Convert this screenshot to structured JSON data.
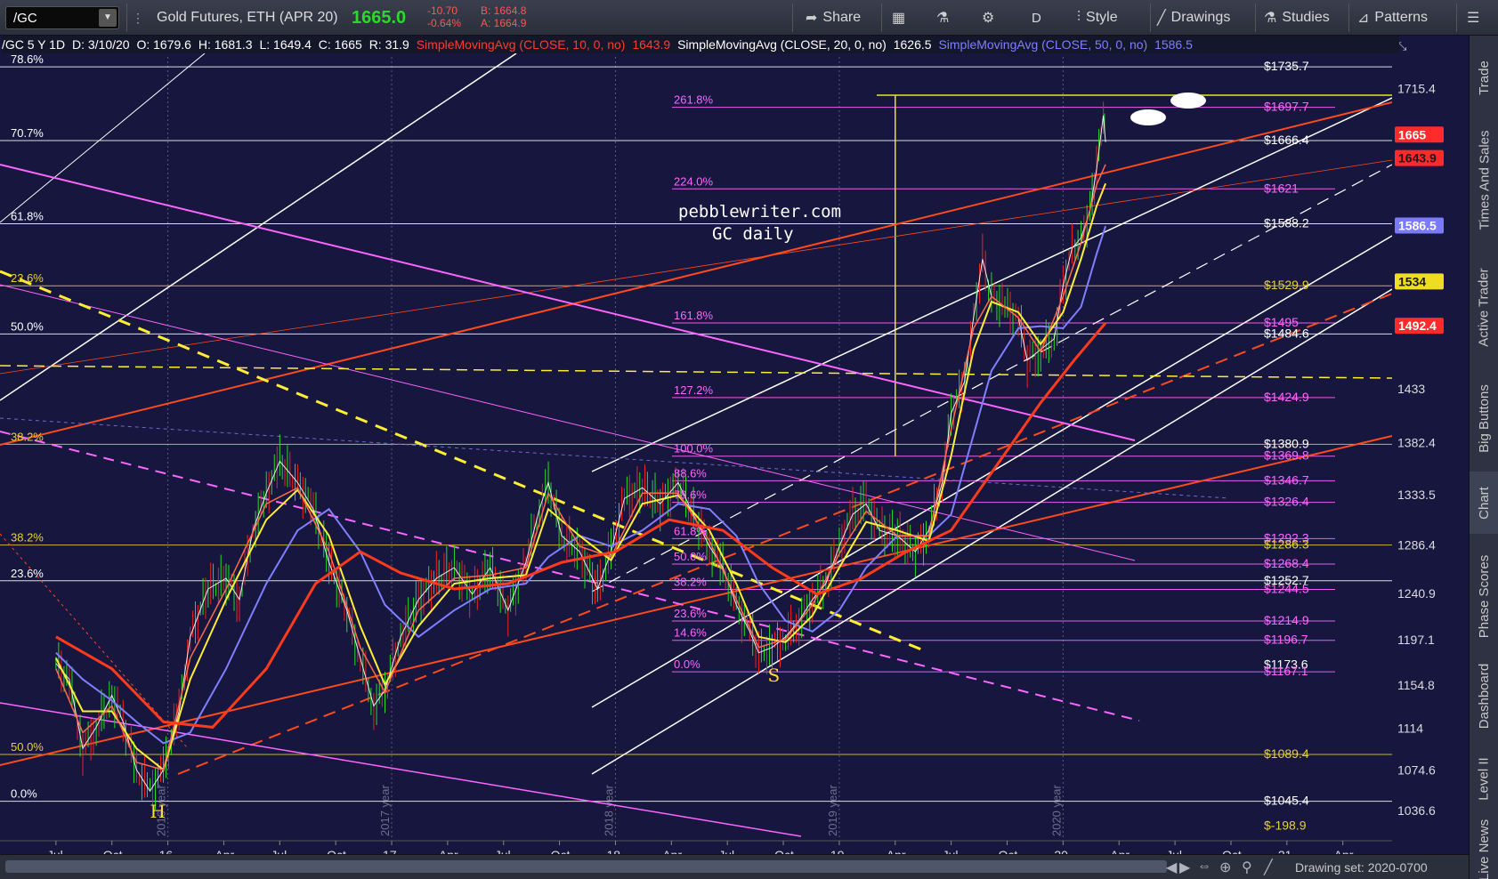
{
  "toolbar": {
    "symbol": "/GC",
    "instrument": "Gold Futures, ETH (APR 20)",
    "last": "1665.0",
    "change": "-10.70",
    "change_pct": "-0.64%",
    "bid": "B: 1664.8",
    "ask": "A: 1664.9",
    "share_label": "Share",
    "period_label": "D",
    "style_label": "Style",
    "drawings_label": "Drawings",
    "studies_label": "Studies",
    "patterns_label": "Patterns"
  },
  "header": {
    "desc": "/GC 5 Y 1D",
    "date": "D: 3/10/20",
    "open": "O: 1679.6",
    "high": "H: 1681.3",
    "low": "L: 1649.4",
    "close": "C: 1665",
    "range": "R: 31.9",
    "sma10": "SimpleMovingAvg (CLOSE, 10, 0, no)",
    "sma10_val": "1643.9",
    "sma20": "SimpleMovingAvg (CLOSE, 20, 0, no)",
    "sma20_val": "1626.5",
    "sma50": "SimpleMovingAvg (CLOSE, 50, 0, no)",
    "sma50_val": "1586.5"
  },
  "watermark": {
    "line1": "pebblewriter.com",
    "line2": "GC daily"
  },
  "sidebar": {
    "tabs": [
      "Trade",
      "Times And Sales",
      "Active Trader",
      "Big Buttons",
      "Chart",
      "Phase Scores",
      "Dashboard",
      "Level II",
      "Live News"
    ]
  },
  "bottom": {
    "drawing_set": "Drawing set: 2020-0700"
  },
  "colors": {
    "background": "#16163f",
    "price_up": "#22dd22",
    "price_down": "#ee2222",
    "sma10": "#ff3b2f",
    "sma20": "#ffffff",
    "sma50": "#7f7fff",
    "fib_pink": "#ff66ff",
    "fib_yellow": "#e6d22a",
    "channel_white": "#ffffff",
    "channel_orange": "#ff4a1c"
  },
  "chart_data": {
    "type": "candlestick",
    "ylim": [
      1010,
      1745
    ],
    "y_ticks": [
      "1715.4",
      "1433",
      "1382.4",
      "1333.5",
      "1286.4",
      "1240.9",
      "1197.1",
      "1154.8",
      "1114",
      "1074.6",
      "1036.6"
    ],
    "x_labels": [
      "Jul",
      "Oct",
      "16",
      "Apr",
      "Jul",
      "Oct",
      "17",
      "Apr",
      "Jul",
      "Oct",
      "18",
      "Apr",
      "Jul",
      "Oct",
      "19",
      "Apr",
      "Jul",
      "Oct",
      "20",
      "Apr",
      "Jul",
      "Oct",
      "21",
      "Apr"
    ],
    "year_labels": [
      "2016 year",
      "2017 year",
      "2018 year",
      "2019 year",
      "2020 year"
    ],
    "price_path": [
      [
        2015.5,
        1175
      ],
      [
        2015.56,
        1160
      ],
      [
        2015.62,
        1095
      ],
      [
        2015.68,
        1115
      ],
      [
        2015.75,
        1145
      ],
      [
        2015.8,
        1120
      ],
      [
        2015.86,
        1075
      ],
      [
        2015.92,
        1055
      ],
      [
        2015.98,
        1075
      ],
      [
        2016.05,
        1130
      ],
      [
        2016.1,
        1200
      ],
      [
        2016.18,
        1245
      ],
      [
        2016.26,
        1255
      ],
      [
        2016.32,
        1235
      ],
      [
        2016.38,
        1300
      ],
      [
        2016.44,
        1335
      ],
      [
        2016.5,
        1365
      ],
      [
        2016.58,
        1345
      ],
      [
        2016.65,
        1320
      ],
      [
        2016.72,
        1270
      ],
      [
        2016.8,
        1225
      ],
      [
        2016.86,
        1180
      ],
      [
        2016.92,
        1135
      ],
      [
        2016.97,
        1150
      ],
      [
        2017.04,
        1200
      ],
      [
        2017.12,
        1235
      ],
      [
        2017.2,
        1255
      ],
      [
        2017.28,
        1265
      ],
      [
        2017.36,
        1240
      ],
      [
        2017.44,
        1265
      ],
      [
        2017.52,
        1225
      ],
      [
        2017.6,
        1270
      ],
      [
        2017.66,
        1320
      ],
      [
        2017.7,
        1345
      ],
      [
        2017.76,
        1295
      ],
      [
        2017.84,
        1280
      ],
      [
        2017.92,
        1245
      ],
      [
        2017.98,
        1280
      ],
      [
        2018.04,
        1330
      ],
      [
        2018.12,
        1340
      ],
      [
        2018.2,
        1325
      ],
      [
        2018.28,
        1345
      ],
      [
        2018.36,
        1310
      ],
      [
        2018.42,
        1285
      ],
      [
        2018.48,
        1265
      ],
      [
        2018.54,
        1230
      ],
      [
        2018.6,
        1205
      ],
      [
        2018.64,
        1185
      ],
      [
        2018.7,
        1190
      ],
      [
        2018.76,
        1200
      ],
      [
        2018.82,
        1215
      ],
      [
        2018.88,
        1235
      ],
      [
        2018.94,
        1250
      ],
      [
        2019.0,
        1285
      ],
      [
        2019.06,
        1315
      ],
      [
        2019.12,
        1325
      ],
      [
        2019.18,
        1300
      ],
      [
        2019.26,
        1295
      ],
      [
        2019.34,
        1280
      ],
      [
        2019.4,
        1300
      ],
      [
        2019.46,
        1345
      ],
      [
        2019.5,
        1410
      ],
      [
        2019.56,
        1440
      ],
      [
        2019.6,
        1500
      ],
      [
        2019.64,
        1555
      ],
      [
        2019.68,
        1520
      ],
      [
        2019.74,
        1510
      ],
      [
        2019.8,
        1500
      ],
      [
        2019.84,
        1460
      ],
      [
        2019.9,
        1470
      ],
      [
        2019.96,
        1480
      ],
      [
        2020.0,
        1530
      ],
      [
        2020.04,
        1565
      ],
      [
        2020.08,
        1575
      ],
      [
        2020.12,
        1600
      ],
      [
        2020.15,
        1640
      ],
      [
        2020.18,
        1690
      ],
      [
        2020.19,
        1665
      ]
    ],
    "sma10": [
      [
        2015.5,
        1170
      ],
      [
        2015.62,
        1110
      ],
      [
        2015.75,
        1135
      ],
      [
        2015.86,
        1082
      ],
      [
        2015.98,
        1075
      ],
      [
        2016.1,
        1180
      ],
      [
        2016.26,
        1245
      ],
      [
        2016.44,
        1325
      ],
      [
        2016.58,
        1340
      ],
      [
        2016.72,
        1280
      ],
      [
        2016.86,
        1190
      ],
      [
        2016.97,
        1148
      ],
      [
        2017.12,
        1225
      ],
      [
        2017.28,
        1255
      ],
      [
        2017.44,
        1258
      ],
      [
        2017.6,
        1265
      ],
      [
        2017.7,
        1335
      ],
      [
        2017.84,
        1285
      ],
      [
        2017.98,
        1275
      ],
      [
        2018.12,
        1335
      ],
      [
        2018.28,
        1335
      ],
      [
        2018.42,
        1290
      ],
      [
        2018.54,
        1235
      ],
      [
        2018.64,
        1190
      ],
      [
        2018.76,
        1198
      ],
      [
        2018.88,
        1230
      ],
      [
        2019.0,
        1278
      ],
      [
        2019.12,
        1318
      ],
      [
        2019.26,
        1295
      ],
      [
        2019.4,
        1295
      ],
      [
        2019.5,
        1395
      ],
      [
        2019.6,
        1490
      ],
      [
        2019.68,
        1520
      ],
      [
        2019.8,
        1500
      ],
      [
        2019.9,
        1468
      ],
      [
        2020.0,
        1520
      ],
      [
        2020.08,
        1570
      ],
      [
        2020.15,
        1625
      ],
      [
        2020.19,
        1644
      ]
    ],
    "sma20": [
      [
        2015.5,
        1180
      ],
      [
        2015.62,
        1130
      ],
      [
        2015.75,
        1130
      ],
      [
        2015.86,
        1095
      ],
      [
        2015.98,
        1075
      ],
      [
        2016.1,
        1160
      ],
      [
        2016.26,
        1235
      ],
      [
        2016.44,
        1310
      ],
      [
        2016.58,
        1338
      ],
      [
        2016.72,
        1295
      ],
      [
        2016.86,
        1210
      ],
      [
        2016.97,
        1155
      ],
      [
        2017.12,
        1210
      ],
      [
        2017.28,
        1250
      ],
      [
        2017.44,
        1255
      ],
      [
        2017.6,
        1258
      ],
      [
        2017.7,
        1320
      ],
      [
        2017.84,
        1295
      ],
      [
        2017.98,
        1272
      ],
      [
        2018.12,
        1325
      ],
      [
        2018.28,
        1333
      ],
      [
        2018.42,
        1300
      ],
      [
        2018.54,
        1250
      ],
      [
        2018.64,
        1200
      ],
      [
        2018.76,
        1195
      ],
      [
        2018.88,
        1220
      ],
      [
        2019.0,
        1265
      ],
      [
        2019.12,
        1308
      ],
      [
        2019.26,
        1300
      ],
      [
        2019.4,
        1290
      ],
      [
        2019.5,
        1370
      ],
      [
        2019.6,
        1470
      ],
      [
        2019.68,
        1515
      ],
      [
        2019.8,
        1505
      ],
      [
        2019.9,
        1475
      ],
      [
        2020.0,
        1505
      ],
      [
        2020.08,
        1555
      ],
      [
        2020.15,
        1605
      ],
      [
        2020.19,
        1626
      ]
    ],
    "sma50": [
      [
        2015.5,
        1185
      ],
      [
        2015.62,
        1160
      ],
      [
        2015.75,
        1140
      ],
      [
        2015.86,
        1120
      ],
      [
        2015.98,
        1100
      ],
      [
        2016.1,
        1110
      ],
      [
        2016.26,
        1170
      ],
      [
        2016.44,
        1250
      ],
      [
        2016.58,
        1300
      ],
      [
        2016.72,
        1320
      ],
      [
        2016.86,
        1280
      ],
      [
        2016.97,
        1230
      ],
      [
        2017.12,
        1200
      ],
      [
        2017.28,
        1225
      ],
      [
        2017.44,
        1245
      ],
      [
        2017.6,
        1250
      ],
      [
        2017.7,
        1275
      ],
      [
        2017.84,
        1295
      ],
      [
        2017.98,
        1285
      ],
      [
        2018.12,
        1300
      ],
      [
        2018.28,
        1325
      ],
      [
        2018.42,
        1320
      ],
      [
        2018.54,
        1295
      ],
      [
        2018.64,
        1250
      ],
      [
        2018.76,
        1215
      ],
      [
        2018.88,
        1205
      ],
      [
        2019.0,
        1225
      ],
      [
        2019.12,
        1265
      ],
      [
        2019.26,
        1295
      ],
      [
        2019.4,
        1295
      ],
      [
        2019.5,
        1315
      ],
      [
        2019.6,
        1390
      ],
      [
        2019.68,
        1450
      ],
      [
        2019.8,
        1490
      ],
      [
        2019.9,
        1492
      ],
      [
        2020.0,
        1490
      ],
      [
        2020.08,
        1510
      ],
      [
        2020.15,
        1560
      ],
      [
        2020.19,
        1586
      ]
    ],
    "sma200": [
      [
        2015.5,
        1200
      ],
      [
        2015.75,
        1170
      ],
      [
        2015.98,
        1120
      ],
      [
        2016.2,
        1115
      ],
      [
        2016.44,
        1170
      ],
      [
        2016.66,
        1250
      ],
      [
        2016.86,
        1280
      ],
      [
        2017.04,
        1260
      ],
      [
        2017.28,
        1245
      ],
      [
        2017.52,
        1250
      ],
      [
        2017.76,
        1270
      ],
      [
        2018.0,
        1280
      ],
      [
        2018.24,
        1310
      ],
      [
        2018.48,
        1300
      ],
      [
        2018.7,
        1265
      ],
      [
        2018.9,
        1240
      ],
      [
        2019.1,
        1255
      ],
      [
        2019.3,
        1280
      ],
      [
        2019.5,
        1300
      ],
      [
        2019.7,
        1360
      ],
      [
        2019.9,
        1420
      ],
      [
        2020.05,
        1460
      ],
      [
        2020.19,
        1495
      ]
    ],
    "fib_left": [
      {
        "label": "78.6%",
        "price": 1735.7,
        "color": "#ffffff"
      },
      {
        "label": "70.7%",
        "price": 1666.4,
        "color": "#ffffff"
      },
      {
        "label": "61.8%",
        "price": 1588.2,
        "color": "#ffffff"
      },
      {
        "label": "23.6%",
        "price": 1529.9,
        "color": "#e6d22a"
      },
      {
        "label": "50.0%",
        "price": 1484.6,
        "color": "#ffffff"
      },
      {
        "label": "38.2%",
        "price": 1380.9,
        "color": "#e6d22a"
      },
      {
        "label": "38.2%",
        "price": 1286.3,
        "color": "#e6d22a"
      },
      {
        "label": "23.6%",
        "price": 1252.7,
        "color": "#ffffff"
      },
      {
        "label": "50.0%",
        "price": 1089.4,
        "color": "#e6d22a"
      },
      {
        "label": "0.0%",
        "price": 1045.4,
        "color": "#ffffff"
      }
    ],
    "fib_mid": [
      {
        "label": "261.8%",
        "price": 1697.7
      },
      {
        "label": "224.0%",
        "price": 1621
      },
      {
        "label": "161.8%",
        "price": 1495
      },
      {
        "label": "127.2%",
        "price": 1424.9
      },
      {
        "label": "100.0%",
        "price": 1369.8
      },
      {
        "label": "88.6%",
        "price": 1346.7
      },
      {
        "label": "78.6%",
        "price": 1326.4
      },
      {
        "label": "61.8%",
        "price": 1292.3
      },
      {
        "label": "50.0%",
        "price": 1268.4
      },
      {
        "label": "38.2%",
        "price": 1244.5
      },
      {
        "label": "23.6%",
        "price": 1214.9
      },
      {
        "label": "14.6%",
        "price": 1196.7
      },
      {
        "label": "0.0%",
        "price": 1167.1
      }
    ],
    "right_labels": [
      {
        "text": "$1735.7",
        "price": 1735.7,
        "color": "#ffffff"
      },
      {
        "text": "$1697.7",
        "price": 1697.7,
        "color": "#ff66ff"
      },
      {
        "text": "$1666.4",
        "price": 1666.4,
        "color": "#ffffff"
      },
      {
        "text": "$1621",
        "price": 1621,
        "color": "#ff66ff"
      },
      {
        "text": "$1588.2",
        "price": 1588.2,
        "color": "#ffffff"
      },
      {
        "text": "$1529.9",
        "price": 1529.9,
        "color": "#e6d22a"
      },
      {
        "text": "$1495",
        "price": 1495,
        "color": "#ff66ff"
      },
      {
        "text": "$1484.6",
        "price": 1484.6,
        "color": "#ffffff"
      },
      {
        "text": "$1424.9",
        "price": 1424.9,
        "color": "#ff66ff"
      },
      {
        "text": "$1380.9",
        "price": 1380.9,
        "color": "#ffffff"
      },
      {
        "text": "$1369.8",
        "price": 1369.8,
        "color": "#ff66ff"
      },
      {
        "text": "$1346.7",
        "price": 1346.7,
        "color": "#ff66ff"
      },
      {
        "text": "$1326.4",
        "price": 1326.4,
        "color": "#ff66ff"
      },
      {
        "text": "$1292.3",
        "price": 1292.3,
        "color": "#ff66ff"
      },
      {
        "text": "$1286.3",
        "price": 1286.3,
        "color": "#e6d22a"
      },
      {
        "text": "$1268.4",
        "price": 1268.4,
        "color": "#ff66ff"
      },
      {
        "text": "$1252.7",
        "price": 1252.7,
        "color": "#ffffff"
      },
      {
        "text": "$1244.5",
        "price": 1244.5,
        "color": "#ff66ff"
      },
      {
        "text": "$1214.9",
        "price": 1214.9,
        "color": "#ff66ff"
      },
      {
        "text": "$1196.7",
        "price": 1196.7,
        "color": "#ff66ff"
      },
      {
        "text": "$1173.6",
        "price": 1173.6,
        "color": "#ffffff"
      },
      {
        "text": "$1167.1",
        "price": 1167.1,
        "color": "#ff66ff"
      },
      {
        "text": "$1089.4",
        "price": 1089.4,
        "color": "#e6d22a"
      },
      {
        "text": "$1045.4",
        "price": 1045.4,
        "color": "#ffffff"
      },
      {
        "text": "$-198.9",
        "price": 1022,
        "color": "#e6d22a"
      }
    ],
    "price_tags": [
      {
        "text": "1665",
        "price": 1672,
        "bg": "#ff2a2a",
        "fg": "#ffffff"
      },
      {
        "text": "1643.9",
        "price": 1650,
        "bg": "#ff2a2a",
        "fg": "#1a1a1a"
      },
      {
        "text": "1586.5",
        "price": 1586.5,
        "bg": "#7a7aff",
        "fg": "#ffffff"
      },
      {
        "text": "1534",
        "price": 1534,
        "bg": "#eedd22",
        "fg": "#1a1a1a"
      },
      {
        "text": "1492.4",
        "price": 1492.4,
        "bg": "#ff2a2a",
        "fg": "#ffffff"
      }
    ],
    "annotations": [
      {
        "text": "H",
        "x": 2015.92,
        "price": 1030,
        "color": "#ffdd33"
      },
      {
        "text": "S",
        "x": 2018.68,
        "price": 1158,
        "color": "#ffdd33"
      }
    ],
    "projection": {
      "x": 2019.25,
      "top": 1709,
      "bottom": 1369.8
    }
  }
}
